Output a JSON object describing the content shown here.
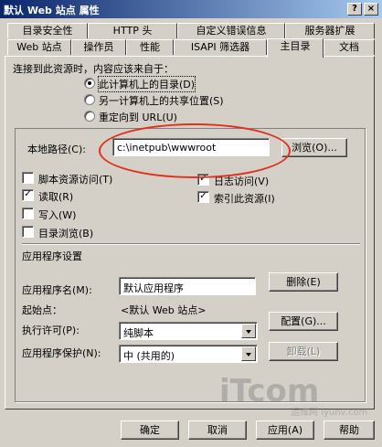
{
  "window": {
    "title": "默认 Web 站点 属性",
    "help_button": "?",
    "close_button": "×"
  },
  "tabs": {
    "row1": [
      "目录安全性",
      "HTTP 头",
      "自定义错误信息",
      "服务器扩展"
    ],
    "row2": [
      "Web 站点",
      "操作员",
      "性能",
      "ISAPI 筛选器",
      "主目录",
      "文档"
    ]
  },
  "source": {
    "heading": "连接到此资源时，内容应该来自于：",
    "options": [
      "此计算机上的目录(D)",
      "另一计算机上的共享位置(S)",
      "重定向到 URL(U)"
    ],
    "selected": 0
  },
  "local_path": {
    "label": "本地路径(C):",
    "value": "c:\\inetpub\\wwwroot",
    "browse_label": "浏览(O)..."
  },
  "permissions": {
    "left": [
      {
        "label": "脚本资源访问(T)",
        "checked": false
      },
      {
        "label": "读取(R)",
        "checked": true
      },
      {
        "label": "写入(W)",
        "checked": false
      },
      {
        "label": "目录浏览(B)",
        "checked": false
      }
    ],
    "right": [
      {
        "label": "日志访问(V)",
        "checked": true
      },
      {
        "label": "索引此资源(I)",
        "checked": true
      }
    ]
  },
  "app_settings": {
    "heading": "应用程序设置",
    "name_label": "应用程序名(M):",
    "name_value": "默认应用程序",
    "remove_label": "删除(E)",
    "start_label": "起始点：",
    "start_value": "<默认 Web 站点>",
    "config_label": "配置(G)...",
    "exec_label": "执行许可(P):",
    "exec_value": "纯脚本",
    "protect_label": "应用程序保护(N):",
    "protect_value": "中 (共用的)",
    "unload_label": "卸载(L)"
  },
  "footer": {
    "ok": "确定",
    "cancel": "取消",
    "apply": "应用(A)",
    "help": "帮助"
  },
  "watermark": {
    "logo": "iTcom",
    "sub": "运维网 iyunv.com"
  },
  "check_glyph": "✓"
}
